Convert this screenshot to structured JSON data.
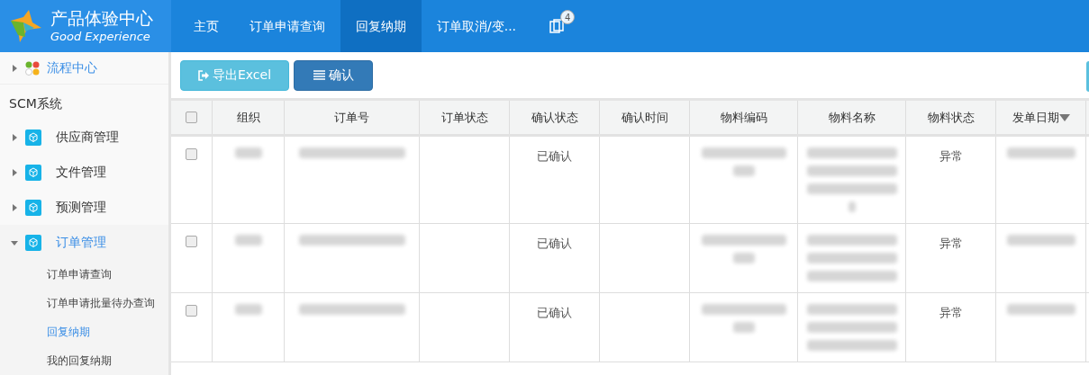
{
  "logo": {
    "title": "产品体验中心",
    "subtitle": "Good Experience"
  },
  "nav": {
    "tabs": [
      {
        "label": "主页",
        "selected": false
      },
      {
        "label": "订单申请查询",
        "selected": false
      },
      {
        "label": "回复纳期",
        "selected": true
      },
      {
        "label": "订单取消/变...",
        "selected": false
      }
    ],
    "badge": "4"
  },
  "sidebar": {
    "top_item": {
      "label": "流程中心",
      "expanded": false
    },
    "section": "SCM系统",
    "items": [
      {
        "label": "供应商管理",
        "expanded": false
      },
      {
        "label": "文件管理",
        "expanded": false
      },
      {
        "label": "预测管理",
        "expanded": false
      },
      {
        "label": "订单管理",
        "expanded": true,
        "children": [
          {
            "label": "订单申请查询",
            "selected": false
          },
          {
            "label": "订单申请批量待办查询",
            "selected": false
          },
          {
            "label": "回复纳期",
            "selected": true
          },
          {
            "label": "我的回复纳期",
            "selected": false
          }
        ]
      }
    ]
  },
  "toolbar": {
    "buttons": [
      {
        "kind": "export",
        "label": "导出Excel"
      },
      {
        "kind": "confirm",
        "label": "确认"
      }
    ]
  },
  "table": {
    "all_checked": false,
    "columns": [
      {
        "label": "组织",
        "sorted": false
      },
      {
        "label": "订单号",
        "sorted": false
      },
      {
        "label": "订单状态",
        "sorted": false
      },
      {
        "label": "确认状态",
        "sorted": false
      },
      {
        "label": "确认时间",
        "sorted": false
      },
      {
        "label": "物料编码",
        "sorted": false
      },
      {
        "label": "物料名称",
        "sorted": false
      },
      {
        "label": "物料状态",
        "sorted": false
      },
      {
        "label": "发单日期",
        "sorted": true
      }
    ],
    "rows": [
      {
        "checked": false,
        "confirm_status": "已确认",
        "material_status": "异常"
      },
      {
        "checked": false,
        "confirm_status": "已确认",
        "material_status": "异常"
      },
      {
        "checked": false,
        "confirm_status": "已确认",
        "material_status": "异常"
      }
    ]
  }
}
